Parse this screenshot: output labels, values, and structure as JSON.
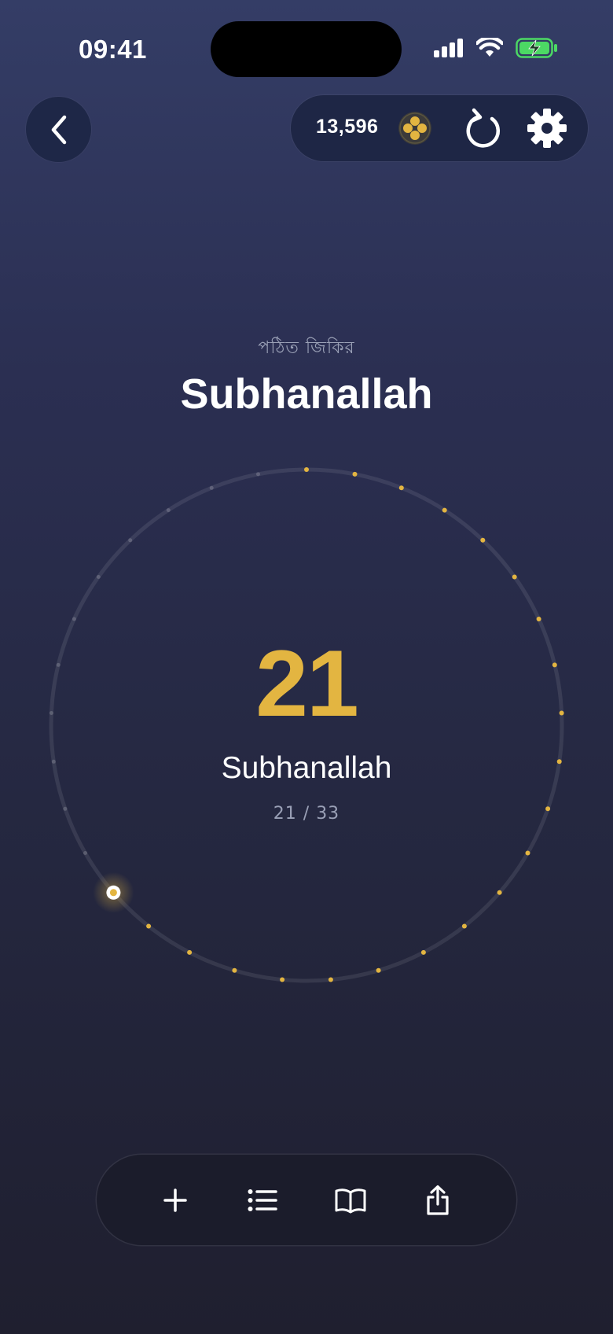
{
  "status_bar": {
    "time": "09:41"
  },
  "header": {
    "coins": "13,596"
  },
  "dhikr": {
    "subtitle": "পঠিত জিকির",
    "title": "Subhanallah",
    "count": "21",
    "label": "Subhanallah",
    "progress": "21 / 33",
    "current": 21,
    "target": 33
  },
  "colors": {
    "accent": "#e3b541",
    "battery": "#4cd964"
  },
  "icons": {
    "back": "chevron-left-icon",
    "coin": "coin-icon",
    "reset": "reset-icon",
    "settings": "gear-icon",
    "add": "plus-icon",
    "list": "list-icon",
    "book": "book-icon",
    "share": "share-icon"
  }
}
